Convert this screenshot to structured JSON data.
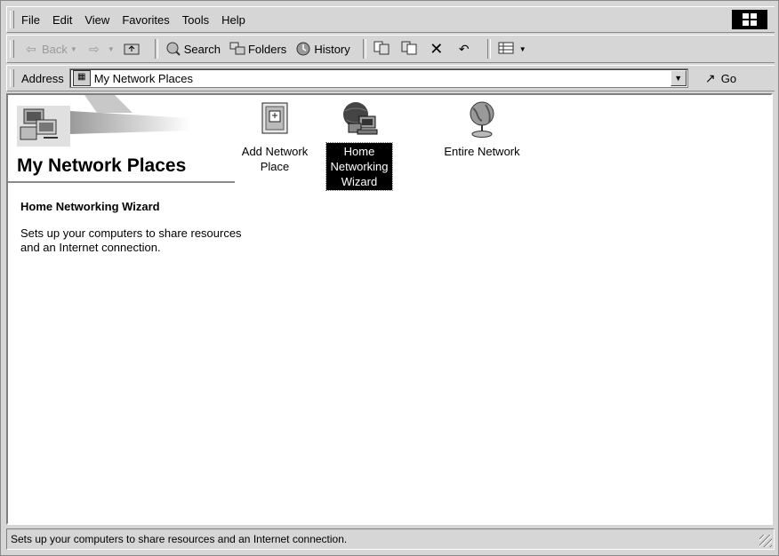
{
  "menu": {
    "items": [
      {
        "label": "File"
      },
      {
        "label": "Edit"
      },
      {
        "label": "View"
      },
      {
        "label": "Favorites"
      },
      {
        "label": "Tools"
      },
      {
        "label": "Help"
      }
    ]
  },
  "toolbar": {
    "back_label": "Back",
    "search_label": "Search",
    "folders_label": "Folders",
    "history_label": "History"
  },
  "address": {
    "label": "Address",
    "value": "My Network Places",
    "go_label": "Go"
  },
  "panel": {
    "title": "My Network Places",
    "selected_heading": "Home Networking Wizard",
    "selected_description": "Sets up your computers to share resources and an Internet connection."
  },
  "items": [
    {
      "label": "Add Network Place",
      "icon": "add-network-place-icon",
      "selected": false
    },
    {
      "label": "Home Networking Wizard",
      "icon": "home-networking-wizard-icon",
      "selected": true
    },
    {
      "label": "Entire Network",
      "icon": "globe-icon",
      "selected": false
    }
  ],
  "status": {
    "text": "Sets up your computers to share resources and an Internet connection."
  }
}
